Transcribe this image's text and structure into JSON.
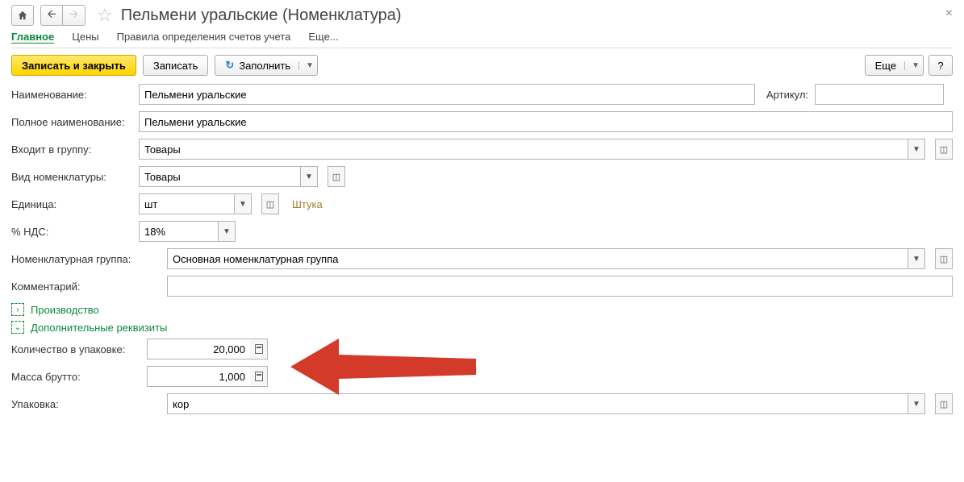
{
  "header": {
    "title": "Пельмени уральские (Номенклатура)"
  },
  "tabs": {
    "main": "Главное",
    "prices": "Цены",
    "rules": "Правила определения счетов учета",
    "more": "Еще..."
  },
  "toolbar": {
    "save_close": "Записать и закрыть",
    "save": "Записать",
    "fill": "Заполнить",
    "more": "Еще",
    "help": "?"
  },
  "fields": {
    "name_label": "Наименование:",
    "name_value": "Пельмени уральские",
    "article_label": "Артикул:",
    "article_value": "",
    "fullname_label": "Полное наименование:",
    "fullname_value": "Пельмени уральские",
    "group_label": "Входит в группу:",
    "group_value": "Товары",
    "type_label": "Вид номенклатуры:",
    "type_value": "Товары",
    "unit_label": "Единица:",
    "unit_value": "шт",
    "unit_hint": "Штука",
    "vat_label": "% НДС:",
    "vat_value": "18%",
    "nomgroup_label": "Номенклатурная группа:",
    "nomgroup_value": "Основная номенклатурная группа",
    "comment_label": "Комментарий:",
    "comment_value": ""
  },
  "sections": {
    "production": "Производство",
    "extra": "Дополнительные реквизиты"
  },
  "extra": {
    "qty_label": "Количество в упаковке:",
    "qty_value": "20,000",
    "gross_label": "Масса брутто:",
    "gross_value": "1,000",
    "pack_label": "Упаковка:",
    "pack_value": "кор"
  }
}
